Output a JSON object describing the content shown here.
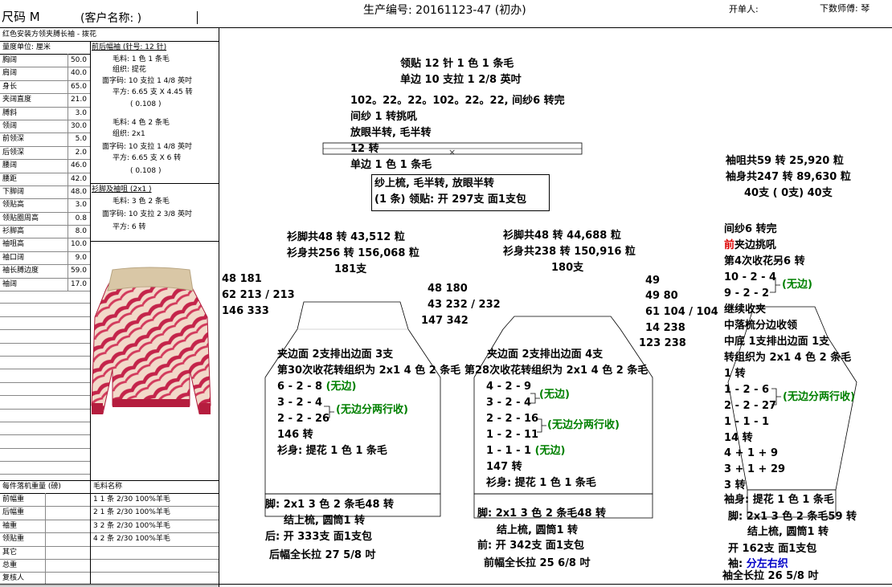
{
  "header": {
    "size": "尺码  M",
    "customer": "(客户名称:                     )",
    "production": "生产编号: 20161123-47 (初办)",
    "creator": "开单人:",
    "master": "下数师傅: 琴"
  },
  "left": {
    "desc": "红色安装方领夹膊长袖 - 拨花",
    "unit": "量度单位: 厘米",
    "measures": [
      {
        "n": "胸阔",
        "v": "50.0"
      },
      {
        "n": "肩阔",
        "v": "40.0"
      },
      {
        "n": "身长",
        "v": "65.0"
      },
      {
        "n": "夹阔直度",
        "v": "21.0"
      },
      {
        "n": "膊斜",
        "v": "3.0"
      },
      {
        "n": "领阔",
        "v": "30.0"
      },
      {
        "n": "前领深",
        "v": "5.0"
      },
      {
        "n": "后领深",
        "v": "2.0"
      },
      {
        "n": "腰阔",
        "v": "46.0"
      },
      {
        "n": "腰距",
        "v": "42.0"
      },
      {
        "n": "下脚阔",
        "v": "48.0"
      },
      {
        "n": "领贴高",
        "v": "3.0"
      },
      {
        "n": "领贴圈周高",
        "v": "0.8"
      },
      {
        "n": "衫脚高",
        "v": "8.0"
      },
      {
        "n": "袖咀高",
        "v": "10.0"
      },
      {
        "n": "袖口阔",
        "v": "9.0"
      },
      {
        "n": "袖长膊边度",
        "v": "59.0"
      },
      {
        "n": "袖阔",
        "v": "17.0"
      }
    ],
    "spec1_title": "前后幅袖 (针号: 12 针)",
    "spec1": [
      "毛料: 1 色 1 条毛",
      "组织: 提花",
      "面字码: 10 支拉 1 4/8 英吋",
      "平方: 6.65 支 X 4.45 转",
      "( 0.108 )"
    ],
    "spec2": [
      "毛料: 4 色 2 条毛",
      "组织: 2x1",
      "面字码: 10 支拉 1 4/8 英吋",
      "平方: 6.65 支 X 6 转",
      "( 0.108 )"
    ],
    "spec3_title": "衫脚及袖咀 (2x1 )",
    "spec3": [
      "毛料: 3 色 2 条毛",
      "面字码: 10 支拉 2 3/8 英吋",
      "平方: 6 转"
    ],
    "weight_title": "每件落机重量 (磅)",
    "weights": [
      "前幅重",
      "后幅重",
      "袖重",
      "领贴重",
      "其它",
      "总重",
      "复核人"
    ],
    "yarn_title": "毛料名称",
    "yarns": [
      "1  1 条 2/30  100%羊毛",
      "2  1 条 2/30  100%羊毛",
      "3  2 条 2/30  100%羊毛",
      "4  2 条 2/30  100%羊毛"
    ]
  },
  "collar": {
    "l1": "领贴  12 针 1 色 1 条毛",
    "l2": "单边 10 支拉 1 2/8 英吋",
    "l3": "102。22。22。102。22。22, 间纱6 转完",
    "l4": "间纱 1 转挑吼",
    "l5": "放眼半转, 毛半转",
    "l6": "12 转",
    "l7": "单边 1 色 1 条毛",
    "b1": "纱上梳, 毛半转, 放眼半转",
    "b2": "(1 条) 领贴: 开 297支 面1支包"
  },
  "back": {
    "s1": "衫脚共48 转 43,512 粒",
    "s2": "衫身共256 转 156,068 粒",
    "s3": "181支",
    "n1": "48   181",
    "n2": "62   213 / 213",
    "n3": "146   333",
    "i1": "夹边面 2支排出边面 3支",
    "i2": "第30次收花转组织为 2x1   4 色 2 条毛",
    "i3": "6 - 2 - 8 ",
    "i3g": "(无边)",
    "i4": "3 - 2 - 4",
    "i5": "2 - 2 - 26",
    "i45g": "(无边分两行收)",
    "i6": "146 转",
    "i7": "衫身: 提花 1 色 1 条毛",
    "f1": "脚: 2x1     3 色 2 条毛48 转",
    "f2": "结上梳, 圆筒1 转",
    "f3": "后: 开 333支 面1支包",
    "f4": "后幅全长拉 27 5/8 吋"
  },
  "front": {
    "s1": "衫脚共48 转 44,688 粒",
    "s2": "衫身共238 转 150,916 粒",
    "s3": "180支",
    "n1": "48   180",
    "n2": "43   232 / 232",
    "n3": "147   342",
    "i1": "夹边面 2支排出边面 4支",
    "i2": "第28次收花转组织为 2x1   4 色 2 条毛",
    "i3": "4 - 2 - 9",
    "i4": "3 - 2 - 4",
    "i34g": "(无边)",
    "i5": "2 - 2 - 16",
    "i6": "1 - 2 - 11",
    "i56g": "(无边分两行收)",
    "i7": "1 - 1 - 1 ",
    "i7g": "(无边)",
    "i8": "147 转",
    "i9": "衫身: 提花 1 色 1 条毛",
    "f1": "脚: 2x1     3 色 2 条毛48 转",
    "f2": "结上梳, 圆筒1 转",
    "f3": "前: 开 342支 面1支包",
    "f4": "前幅全长拉 25 6/8 吋"
  },
  "neck": {
    "n1": "49",
    "n2": "49   80",
    "n3": "61   104 / 104",
    "n4": "14   238",
    "n5": "123   238"
  },
  "sleeve": {
    "s1": "袖咀共59 转 25,920 粒",
    "s2": "袖身共247 转 89,630 粒",
    "s3": "40支 ( 0支) 40支",
    "i1": "间纱6 转完",
    "i2r": "前",
    "i2": "夹边挑吼",
    "i3": "第4次收花另6 转",
    "i4": "10 - 2 - 4",
    "i5": "9 - 2 - 2",
    "i45g": "(无边)",
    "i6": "继续收夹",
    "i7": "中落梳分边收领",
    "i8": "中底 1支排出边面 1支",
    "i9": "转组织为 2x1   4 色 2 条毛",
    "i10": "1 转",
    "i11": "1 - 2 - 6",
    "i12": "2 - 2 - 27",
    "i1112g": "(无边分两行收)",
    "i13": "1 - 1 - 1",
    "i14": "14 转",
    "i15": "4 + 1 + 9",
    "i16": "3 + 1 + 29",
    "i17": "3 转",
    "i18": "袖身: 提花 1 色 1 条毛",
    "f1": "脚: 2x1     3 色 2 条毛59 转",
    "f2": "结上梳, 圆筒1 转",
    "f3": "开 162支 面1支包",
    "f4a": "袖: ",
    "f4b": "分左右织",
    "f5": "袖全长拉 26 5/8 吋"
  }
}
